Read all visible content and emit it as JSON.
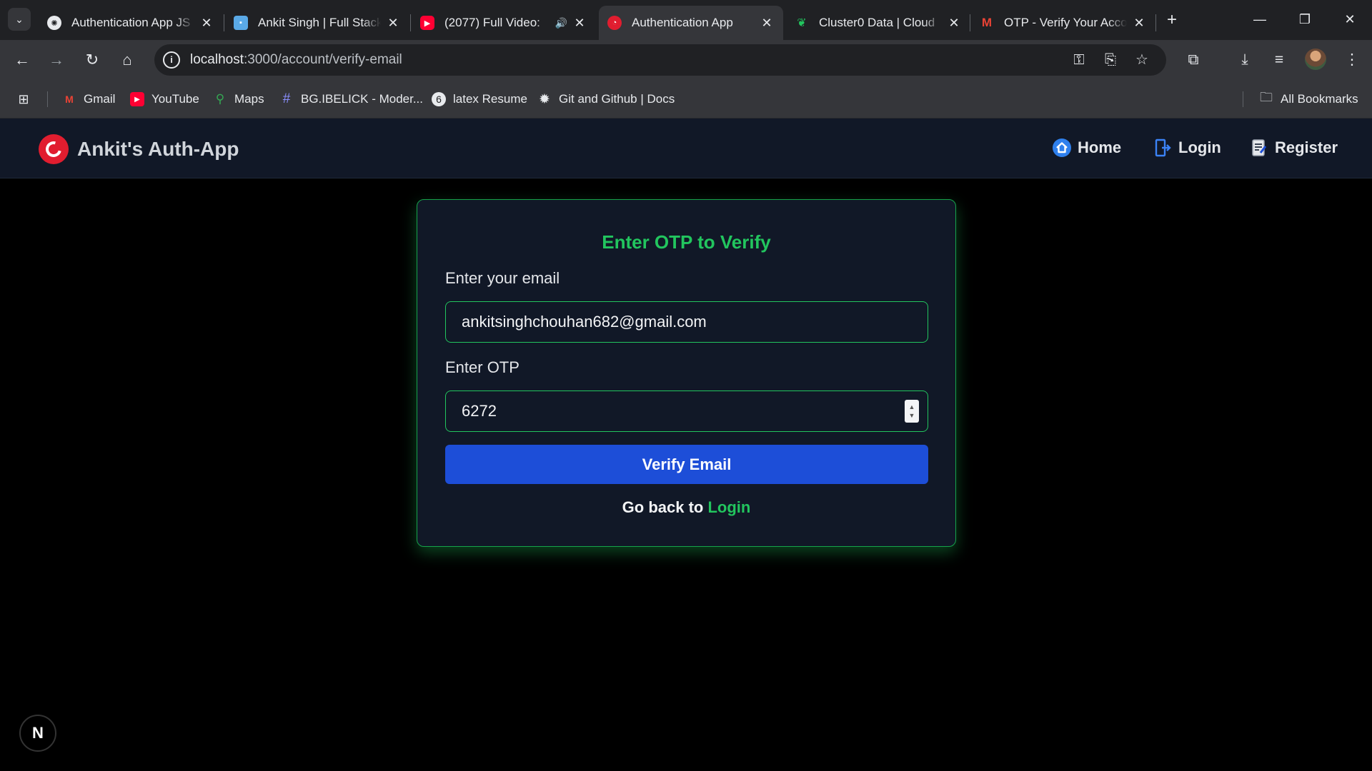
{
  "browser": {
    "tabs": [
      {
        "title": "Authentication App JS",
        "icon": "openai-icon",
        "active": false
      },
      {
        "title": "Ankit Singh | Full Stack",
        "icon": "portfolio-icon",
        "active": false
      },
      {
        "title": "(2077) Full Video: ",
        "icon": "youtube-icon",
        "active": false,
        "audio": true
      },
      {
        "title": "Authentication App",
        "icon": "auth-app-icon",
        "active": true
      },
      {
        "title": "Cluster0 Data | Cloud",
        "icon": "mongodb-icon",
        "active": false
      },
      {
        "title": "OTP - Verify Your Acco",
        "icon": "gmail-icon",
        "active": false
      }
    ],
    "url_host": "localhost",
    "url_path": ":3000/account/verify-email",
    "bookmarks": [
      {
        "label": "Gmail",
        "icon": "gmail-icon"
      },
      {
        "label": "YouTube",
        "icon": "youtube-icon"
      },
      {
        "label": "Maps",
        "icon": "maps-icon"
      },
      {
        "label": "BG.IBELICK - Moder...",
        "icon": "hash-icon"
      },
      {
        "label": "latex Resume",
        "icon": "overleaf-icon"
      },
      {
        "label": "Git and Github | Docs",
        "icon": "gear-icon"
      }
    ],
    "all_bookmarks": "All Bookmarks"
  },
  "app": {
    "brand": "Ankit's Auth-App",
    "nav": {
      "home": "Home",
      "login": "Login",
      "register": "Register"
    },
    "card": {
      "title": "Enter OTP to Verify",
      "email_label": "Enter your email",
      "email_value": "ankitsinghchouhan682@gmail.com",
      "otp_label": "Enter OTP",
      "otp_value": "6272",
      "submit": "Verify Email",
      "back_text": "Go back to",
      "back_link": "Login"
    },
    "dev_badge": "N"
  },
  "colors": {
    "accent_green": "#22c55e",
    "button_blue": "#1d4ed8",
    "nav_bg": "#111827"
  }
}
